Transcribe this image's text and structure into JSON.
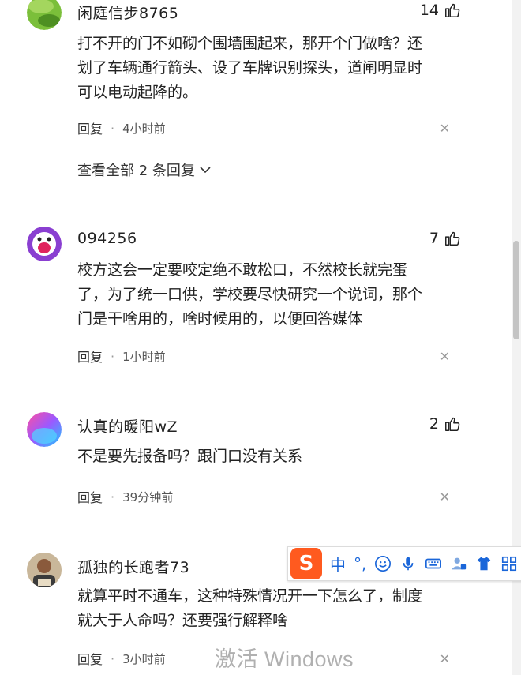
{
  "comments": [
    {
      "username": "闲庭信步8765",
      "likes": "14",
      "text_lines": [
        "打不开的门不如砌个围墙围起来，那开个门做啥？还",
        "划了车辆通行箭头、设了车牌识别探头，道闸明显时",
        "可以电动起降的。"
      ],
      "reply_label": "回复",
      "time": "4小时前",
      "view_all": "查看全部 2 条回复"
    },
    {
      "username": "094256",
      "likes": "7",
      "text_lines": [
        "校方这会一定要咬定绝不敢松口，不然校长就完蛋",
        "了，为了统一口供，学校要尽快研究一个说词，那个",
        "门是干啥用的，啥时候用的，以便回答媒体"
      ],
      "reply_label": "回复",
      "time": "1小时前"
    },
    {
      "username": "认真的暖阳wZ",
      "likes": "2",
      "text_lines": [
        "不是要先报备吗？跟门口没有关系"
      ],
      "reply_label": "回复",
      "time": "39分钟前"
    },
    {
      "username": "孤独的长跑者73",
      "text_lines": [
        "就算平时不通车，这种特殊情况开一下怎么了，制度",
        "就大于人命吗？还要强行解释啥"
      ],
      "reply_label": "回复",
      "time": "3小时前"
    }
  ],
  "ime_toolbar": {
    "logo": "S",
    "mode": "中",
    "punct": "°,",
    "accent_color": "#1a66d9",
    "logo_color": "#ff5a1f",
    "icons": [
      "emoji-icon",
      "microphone-icon",
      "keyboard-icon",
      "user-icon",
      "shirt-icon",
      "grid-icon"
    ]
  },
  "watermark": "激活 Windows"
}
